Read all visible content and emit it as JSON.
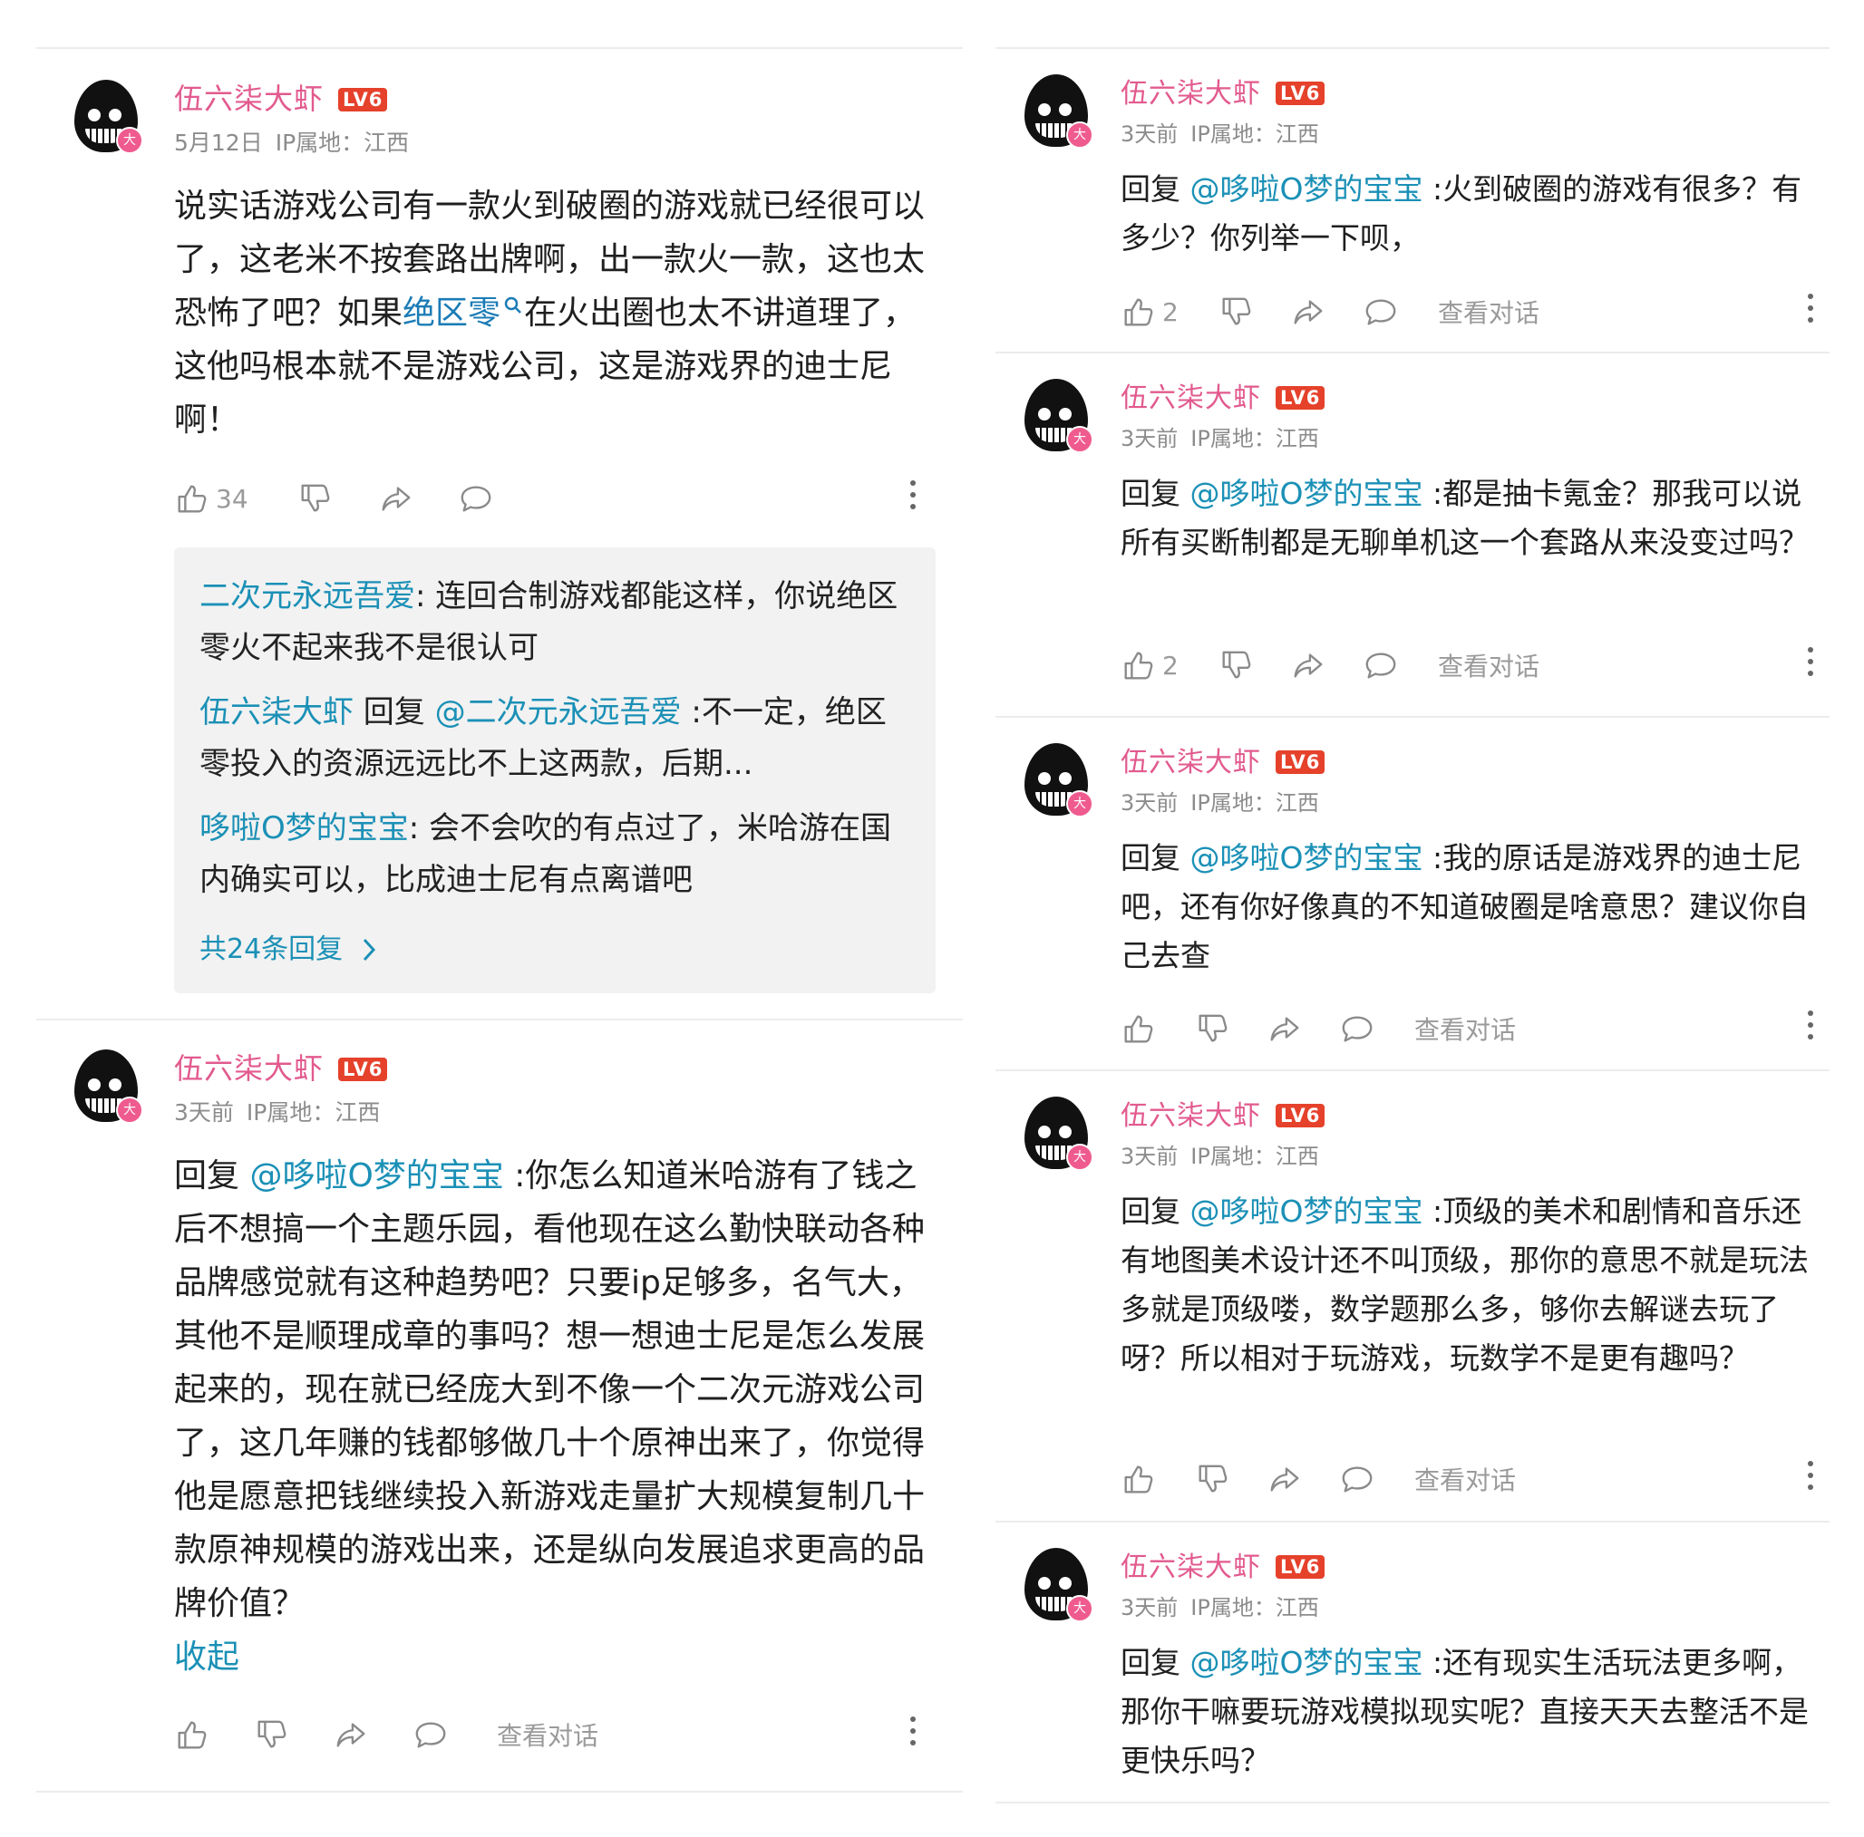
{
  "user": {
    "name": "伍六柒大虾",
    "level": "LV6",
    "avatar_badge": "大"
  },
  "accent": {
    "name": "#e25a8e",
    "link": "#1b90b6",
    "level_badge": "#e5412b"
  },
  "icons": [
    "thumb-up-icon",
    "thumb-down-icon",
    "share-icon",
    "comment-icon",
    "more-icon",
    "chevron-right-icon",
    "search-icon"
  ],
  "left": {
    "c1": {
      "date": "5月12日",
      "ip": "IP属地：江西",
      "text_a": "说实话游戏公司有一款火到破圈的游戏就已经很可以了，这老米不按套路出牌啊，出一款火一款，这也太恐怖了吧？如果",
      "link": "绝区零",
      "text_b": "在火出圈也太不讲道理了，这他吗根本就不是游戏公司，这是游戏界的迪士尼啊！",
      "likes": "34",
      "replies": [
        {
          "name": "二次元永远吾爱",
          "sep": ": ",
          "text": "连回合制游戏都能这样，你说绝区零火不起来我不是很认可"
        },
        {
          "name": "伍六柒大虾",
          "mid": " 回复 ",
          "mention": "@二次元永远吾爱",
          "text": " :不一定，绝区零投入的资源远远比不上这两款，后期..."
        },
        {
          "name": "哆啦O梦的宝宝",
          "sep": ": ",
          "text": "会不会吹的有点过了，米哈游在国内确实可以，比成迪士尼有点离谱吧"
        }
      ],
      "more_replies": "共24条回复"
    },
    "c2": {
      "date": "3天前",
      "ip": "IP属地：江西",
      "prefix": "回复 ",
      "mention": "@哆啦O梦的宝宝",
      "text": " :你怎么知道米哈游有了钱之后不想搞一个主题乐园，看他现在这么勤快联动各种品牌感觉就有这种趋势吧？只要ip足够多，名气大，其他不是顺理成章的事吗？想一想迪士尼是怎么发展起来的，现在就已经庞大到不像一个二次元游戏公司了，这几年赚的钱都够做几十个原神出来了，你觉得他是愿意把钱继续投入新游戏走量扩大规模复制几十款原神规模的游戏出来，还是纵向发展追求更高的品牌价值？",
      "collapse": "收起",
      "view_conv": "查看对话"
    }
  },
  "right": [
    {
      "date": "3天前",
      "ip": "IP属地：江西",
      "prefix": "回复 ",
      "mention": "@哆啦O梦的宝宝",
      "text": " :火到破圈的游戏有很多？有多少？你列举一下呗，",
      "likes": "2",
      "view_conv": "查看对话"
    },
    {
      "date": "3天前",
      "ip": "IP属地：江西",
      "prefix": "回复 ",
      "mention": "@哆啦O梦的宝宝",
      "text": " :都是抽卡氪金？那我可以说所有买断制都是无聊单机这一个套路从来没变过吗？",
      "likes": "2",
      "view_conv": "查看对话"
    },
    {
      "date": "3天前",
      "ip": "IP属地：江西",
      "prefix": "回复 ",
      "mention": "@哆啦O梦的宝宝",
      "text": " :我的原话是游戏界的迪士尼吧，还有你好像真的不知道破圈是啥意思？建议你自己去查",
      "likes": "",
      "view_conv": "查看对话"
    },
    {
      "date": "3天前",
      "ip": "IP属地：江西",
      "prefix": "回复 ",
      "mention": "@哆啦O梦的宝宝",
      "text": " :顶级的美术和剧情和音乐还有地图美术设计还不叫顶级，那你的意思不就是玩法多就是顶级喽，数学题那么多，够你去解谜去玩了呀？所以相对于玩游戏，玩数学不是更有趣吗？",
      "likes": "",
      "view_conv": "查看对话"
    },
    {
      "date": "3天前",
      "ip": "IP属地：江西",
      "prefix": "回复 ",
      "mention": "@哆啦O梦的宝宝",
      "text": " :还有现实生活玩法更多啊，那你干嘛要玩游戏模拟现实呢？直接天天去整活不是更快乐吗？",
      "likes": "",
      "view_conv": ""
    }
  ]
}
